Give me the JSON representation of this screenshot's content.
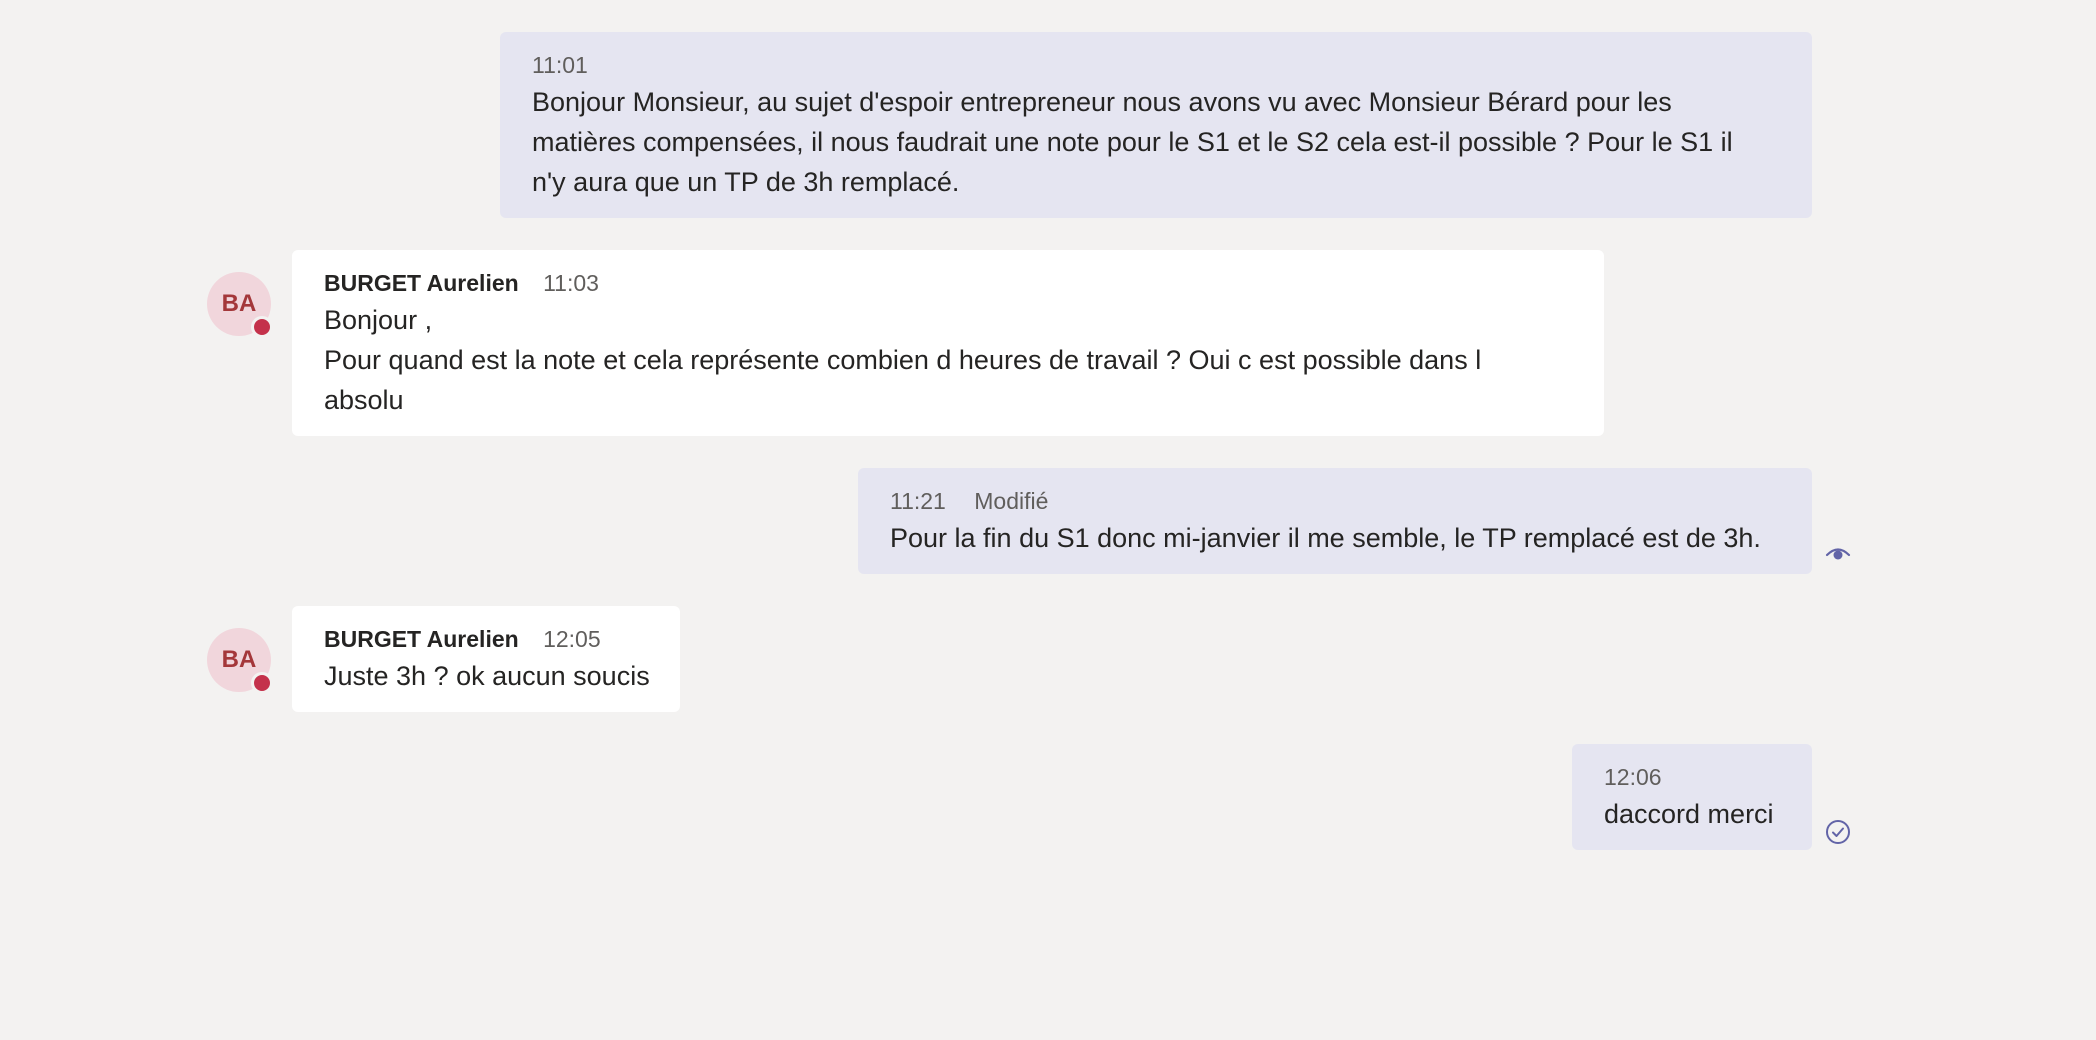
{
  "messages": [
    {
      "time": "11:01",
      "lines": [
        "Bonjour Monsieur, au sujet d'espoir entrepreneur nous avons vu avec Monsieur Bérard pour les",
        "matières compensées, il nous faudrait une note pour le S1 et le S2 cela est-il possible ? Pour le S1 il",
        "n'y aura que un TP de 3h remplacé."
      ]
    },
    {
      "author": "BURGET Aurelien",
      "initials": "BA",
      "time": "11:03",
      "lines": [
        "Bonjour ,",
        "Pour quand est la note et cela représente combien d heures de travail ? Oui c est possible dans l",
        "absolu"
      ]
    },
    {
      "time": "11:21",
      "edited": "Modifié",
      "lines": [
        "Pour la fin du S1 donc mi-janvier il me semble, le TP remplacé est de 3h."
      ],
      "status_icon": "eye-icon"
    },
    {
      "author": "BURGET Aurelien",
      "initials": "BA",
      "time": "12:05",
      "lines": [
        "Juste 3h ? ok aucun soucis"
      ]
    },
    {
      "time": "12:06",
      "lines": [
        "daccord merci"
      ],
      "status_icon": "check-circle-icon"
    }
  ],
  "colors": {
    "background": "#f3f2f1",
    "my_bubble": "#e5e5f1",
    "their_bubble": "#ffffff",
    "avatar_bg": "#f1d6dc",
    "avatar_text": "#a4373a",
    "presence_busy": "#c4314b",
    "status_icon": "#6264a7"
  }
}
